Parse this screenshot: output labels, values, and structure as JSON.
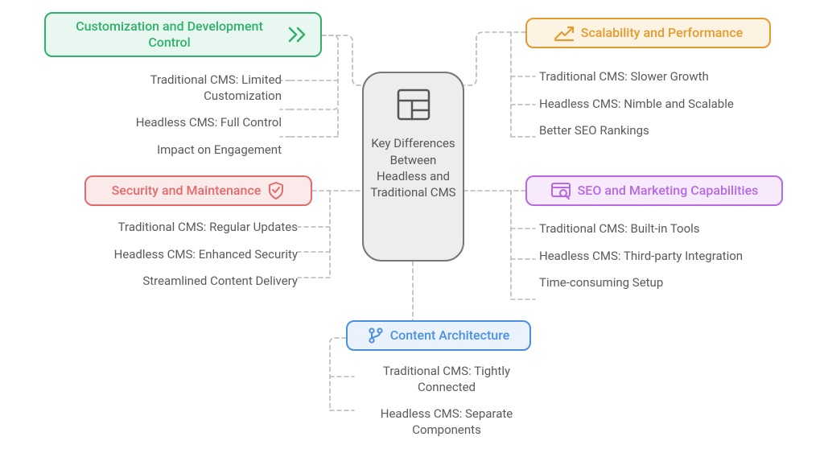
{
  "center": {
    "title": "Key Differences Between Headless and Traditional CMS"
  },
  "categories": {
    "customization": {
      "title": "Customization and Development Control",
      "items": [
        "Traditional CMS: Limited Customization",
        "Headless CMS: Full Control",
        "Impact on Engagement"
      ]
    },
    "security": {
      "title": "Security and Maintenance",
      "items": [
        "Traditional CMS: Regular Updates",
        "Headless CMS: Enhanced Security",
        "Streamlined Content Delivery"
      ]
    },
    "scalability": {
      "title": "Scalability and Performance",
      "items": [
        "Traditional CMS: Slower Growth",
        "Headless CMS: Nimble and Scalable",
        "Better SEO Rankings"
      ]
    },
    "seo": {
      "title": "SEO and Marketing Capabilities",
      "items": [
        "Traditional CMS: Built-in Tools",
        "Headless CMS: Third-party Integration",
        "Time-consuming Setup"
      ]
    },
    "architecture": {
      "title": "Content Architecture",
      "items": [
        "Traditional CMS: Tightly Connected",
        "Headless CMS: Separate Components"
      ]
    }
  }
}
